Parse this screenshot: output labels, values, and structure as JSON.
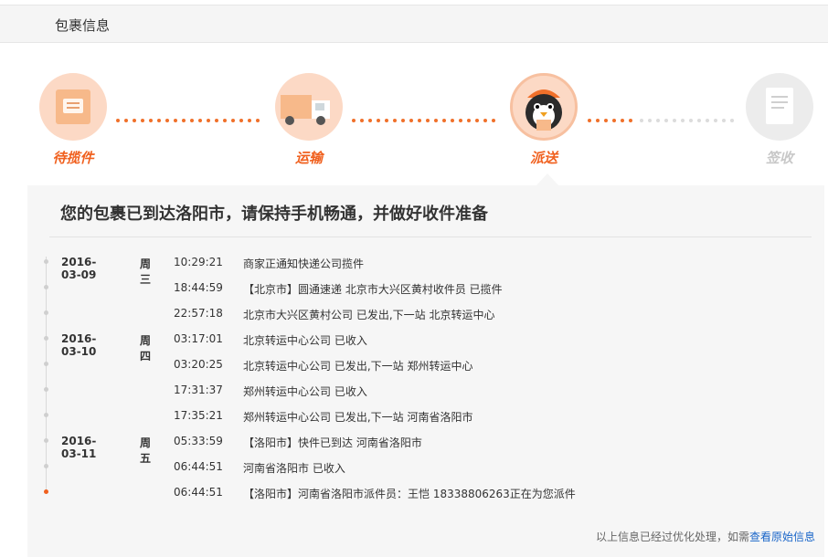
{
  "header": {
    "title": "包裹信息"
  },
  "steps": [
    {
      "label": "待揽件",
      "icon": "package-note-icon",
      "active": true
    },
    {
      "label": "运输",
      "icon": "truck-icon",
      "active": true
    },
    {
      "label": "派送",
      "icon": "courier-penguin-icon",
      "active": true
    },
    {
      "label": "签收",
      "icon": "signed-document-icon",
      "active": false
    }
  ],
  "panel": {
    "title": "您的包裹已到达洛阳市，请保持手机畅通，并做好收件准备",
    "events": [
      {
        "date": "2016-03-09",
        "weekday": "周三",
        "time": "10:29:21",
        "desc": "商家正通知快递公司揽件"
      },
      {
        "date": "",
        "weekday": "",
        "time": "18:44:59",
        "desc": "【北京市】圆通速递 北京市大兴区黄村收件员 已揽件"
      },
      {
        "date": "",
        "weekday": "",
        "time": "22:57:18",
        "desc": "北京市大兴区黄村公司 已发出,下一站 北京转运中心"
      },
      {
        "date": "2016-03-10",
        "weekday": "周四",
        "time": "03:17:01",
        "desc": "北京转运中心公司 已收入"
      },
      {
        "date": "",
        "weekday": "",
        "time": "03:20:25",
        "desc": "北京转运中心公司 已发出,下一站 郑州转运中心"
      },
      {
        "date": "",
        "weekday": "",
        "time": "17:31:37",
        "desc": "郑州转运中心公司 已收入"
      },
      {
        "date": "",
        "weekday": "",
        "time": "17:35:21",
        "desc": "郑州转运中心公司 已发出,下一站 河南省洛阳市"
      },
      {
        "date": "2016-03-11",
        "weekday": "周五",
        "time": "05:33:59",
        "desc": "【洛阳市】快件已到达 河南省洛阳市"
      },
      {
        "date": "",
        "weekday": "",
        "time": "06:44:51",
        "desc": "河南省洛阳市 已收入"
      },
      {
        "date": "",
        "weekday": "",
        "time": "06:44:51",
        "desc": "【洛阳市】河南省洛阳市派件员：王恺 18338806263正在为您派件"
      }
    ],
    "footer_note": "以上信息已经过优化处理，如需",
    "footer_link": "查看原始信息"
  },
  "colors": {
    "accent": "#f0601e",
    "panel_bg": "#f6f6f6",
    "inactive": "#c8c8c8"
  }
}
